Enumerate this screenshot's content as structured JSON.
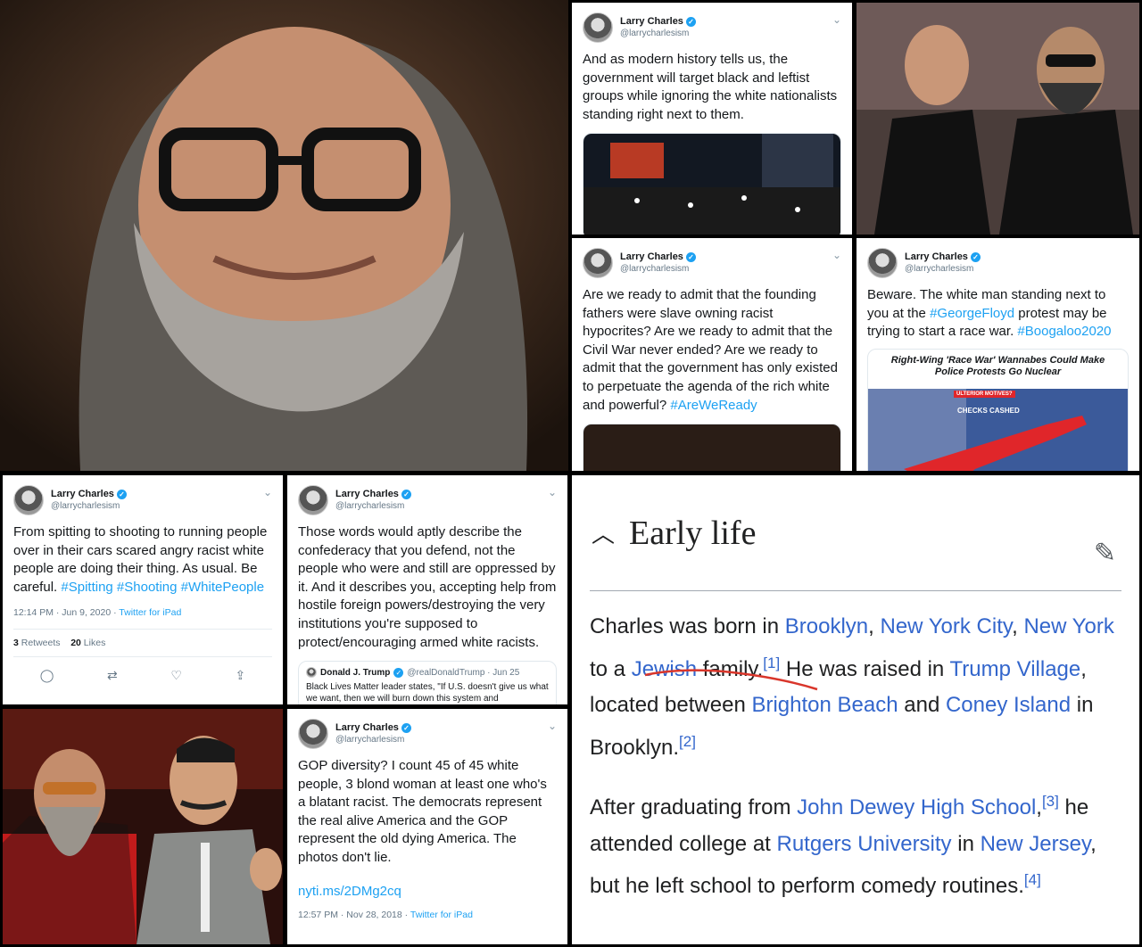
{
  "tweet_author": {
    "name": "Larry Charles",
    "handle": "@larrycharlesism"
  },
  "tweet1": {
    "text": "And as modern history tells us, the government will target black and leftist groups while ignoring the white nationalists standing right next to them."
  },
  "tweet2": {
    "text": "Are we ready to admit that the founding fathers were slave owning racist hypocrites? Are we ready to admit that the Civil War never ended? Are we ready to admit that the government has only existed to perpetuate the agenda of the rich white and powerful?",
    "hashtag": "#AreWeReady"
  },
  "tweet3": {
    "pre": "Beware. The white man standing next to you at the",
    "tag1": "#GeorgeFloyd",
    "mid": "protest may be trying to start a race war.",
    "tag2": "#Boogaloo2020",
    "card_headline": "Right-Wing 'Race War' Wannabes Could Make Police Protests Go Nuclear",
    "card_badge": "ULTERIOR MOTIVES?",
    "card_sign": "CHECKS CASHED"
  },
  "tweet4": {
    "text": "From spitting to shooting to running people over in their cars scared angry racist white people are doing their thing. As usual. Be careful.",
    "tags": [
      "#Spitting",
      "#Shooting",
      "#WhitePeople"
    ],
    "time": "12:14 PM · Jun 9, 2020 · ",
    "source": "Twitter for iPad",
    "retweets": "3",
    "retweets_label": " Retweets",
    "likes": "20",
    "likes_label": " Likes"
  },
  "tweet5": {
    "text": "Those words would aptly describe the confederacy that you defend, not the people who were and still are oppressed by it. And it describes you, accepting help from hostile foreign powers/destroying the very institutions you're supposed to protect/encouraging armed white racists.",
    "quote_name": "Donald J. Trump",
    "quote_handle": "@realDonaldTrump · Jun 25",
    "quote_text": "Black Lives Matter leader states, \"If U.S. doesn't give us what we want, then we will burn down this system and"
  },
  "tweet6": {
    "text": "GOP diversity? I count 45 of 45 white people, 3 blond woman at least one who's a blatant racist. The democrats represent the real alive America and the GOP represent the old dying America. The photos don't lie.",
    "link": "nyti.ms/2DMg2cq",
    "time": "12:57 PM · Nov 28, 2018 · ",
    "source": "Twitter for iPad"
  },
  "wiki": {
    "heading": "Early life",
    "p1": [
      "Charles was born in ",
      "Brooklyn",
      ", ",
      "New York City",
      ", ",
      "New York",
      " to a ",
      "Jewish",
      " family.",
      "[1]",
      " He was raised in ",
      "Trump Village",
      ", located between ",
      "Brighton Beach",
      " and ",
      "Coney Island",
      " in Brooklyn.",
      "[2]"
    ],
    "p2": [
      "After graduating from ",
      "John Dewey High School",
      ",",
      "[3]",
      " he attended college at ",
      "Rutgers University",
      " in ",
      "New Jersey",
      ", but he left school to perform comedy routines.",
      "[4]"
    ]
  },
  "colors": {
    "twitter_blue": "#1da1f2",
    "wiki_link": "#3366cc",
    "annotation_red": "#d9362b"
  },
  "icons": [
    "verified-icon",
    "chevron-down-icon",
    "reply-icon",
    "retweet-icon",
    "like-icon",
    "share-icon",
    "collapse-caret-icon",
    "edit-pencil-icon"
  ]
}
